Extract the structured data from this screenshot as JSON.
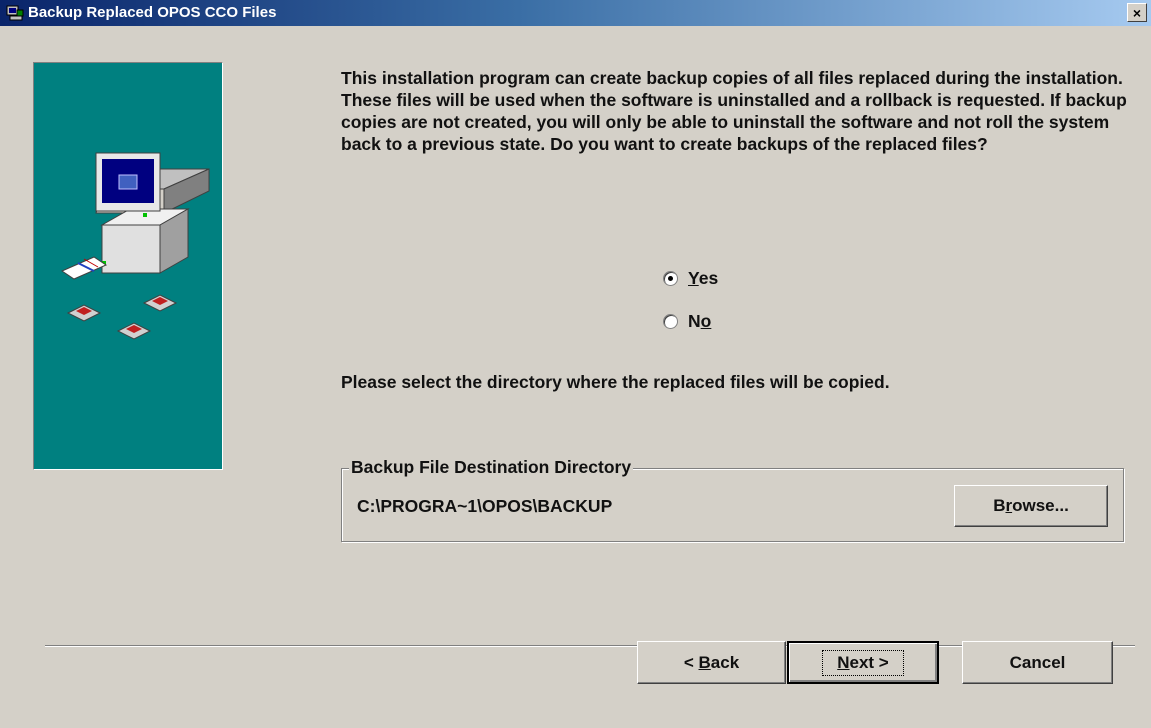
{
  "window": {
    "title": "Backup Replaced OPOS CCO Files",
    "title_icon": "installer-icon",
    "close_label": "×"
  },
  "sidebar": {
    "illustration": "computer-with-disks",
    "panel_color": "#008080"
  },
  "content": {
    "intro_text": "This installation program can create backup copies of all files replaced during the installation. These files will be used when the software is uninstalled and a rollback is requested.  If backup copies are not created, you will only be able to uninstall the software and not roll the system back to a previous state.  Do you want to create backups of the replaced files?",
    "options": [
      {
        "label_prefix": "",
        "label_mnemonic": "Y",
        "label_suffix": "es",
        "selected": true
      },
      {
        "label_prefix": "N",
        "label_mnemonic": "o",
        "label_suffix": "",
        "selected": false
      }
    ],
    "select_dir_text": "Please select the directory where the replaced  files will be copied."
  },
  "destination": {
    "group_label": "Backup File Destination Directory",
    "path": "C:\\PROGRA~1\\OPOS\\BACKUP",
    "browse_prefix": "B",
    "browse_mnemonic": "r",
    "browse_suffix": "owse..."
  },
  "footer": {
    "back_prefix": "< ",
    "back_mnemonic": "B",
    "back_suffix": "ack",
    "next_mnemonic": "N",
    "next_suffix": "ext >",
    "cancel_label": "Cancel"
  }
}
